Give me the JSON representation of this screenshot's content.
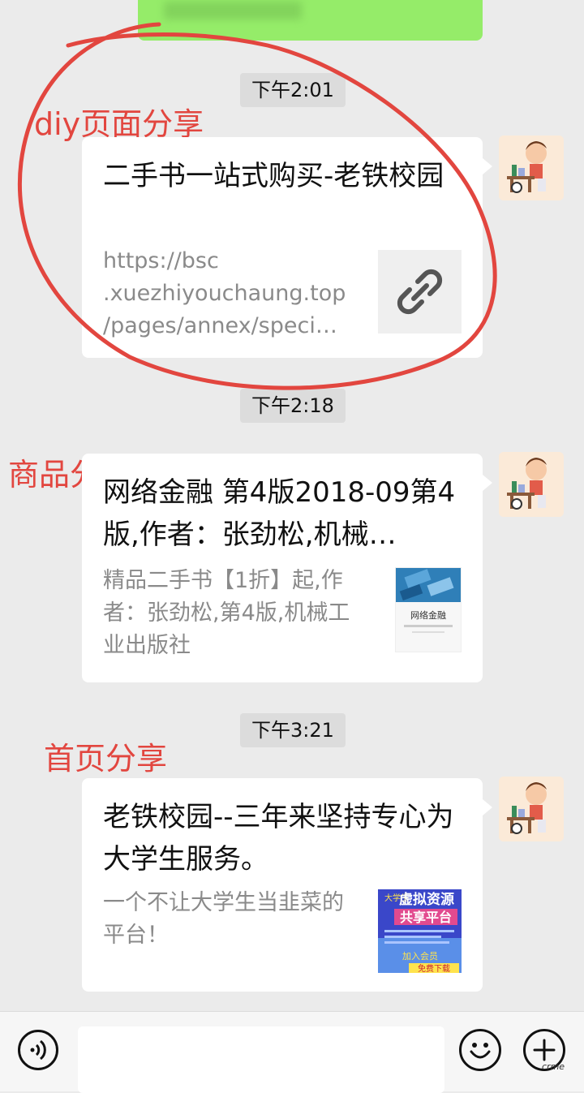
{
  "colors": {
    "bubble_green": "#95ec69",
    "annotation_red": "#e2463f",
    "background": "#ebebeb"
  },
  "messages": [
    {
      "time": "下午2:01",
      "annotation": "diy页面分享",
      "title": "二手书一站式购买-老铁校园",
      "url_lines": [
        "https://bsc",
        ".xuezhiyouchaung.top",
        "/pages/annex/specia…"
      ],
      "thumb_icon": "link-icon"
    },
    {
      "time": "下午2:18",
      "annotation": "商品分享",
      "title": "网络金融 第4版2018-09第4版,作者：张劲松,机械…",
      "description": "精品二手书【1折】起,作者：张劲松,第4版,机械工业出版社",
      "thumb_icon": "book-cover-icon",
      "thumb_text": "网络金融"
    },
    {
      "time": "下午3:21",
      "annotation": "首页分享",
      "title": "老铁校园--三年来坚持专心为大学生服务。",
      "description": "一个不让大学生当韭菜的平台！",
      "thumb_icon": "promo-poster-icon",
      "thumb_line1": "虚拟资源",
      "thumb_line2": "共享平台",
      "thumb_side": "大学生",
      "thumb_cta": "加入会员",
      "thumb_cta2": "免费下载"
    }
  ],
  "bottom_bar": {
    "voice_icon": "voice-icon",
    "emoji_icon": "emoji-icon",
    "plus_icon": "plus-icon"
  },
  "watermark": "crme"
}
